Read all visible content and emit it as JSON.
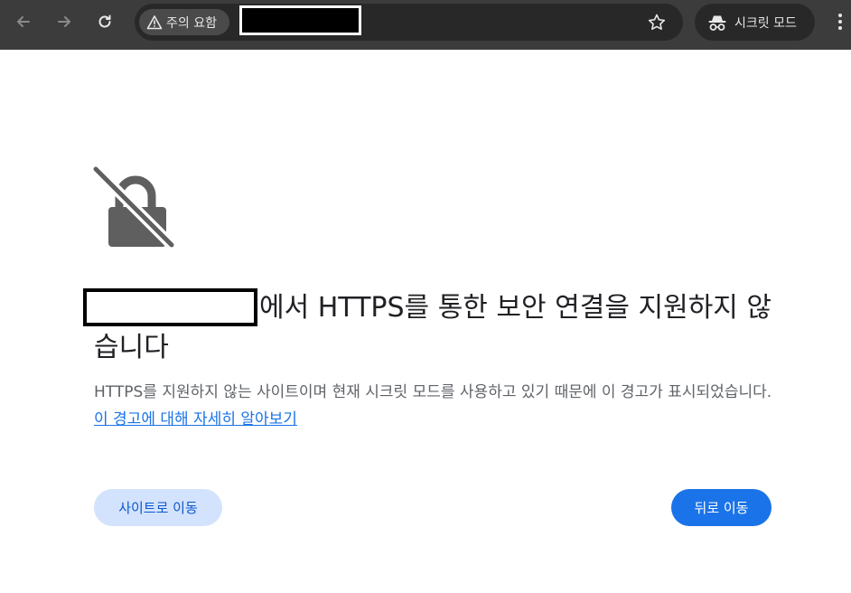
{
  "toolbar": {
    "back_icon": "arrow-left-icon",
    "forward_icon": "arrow-right-icon",
    "reload_icon": "reload-icon",
    "security_chip_label": "주의 요함",
    "security_chip_icon": "warning-triangle-icon",
    "bookmark_icon": "star-icon",
    "incognito_label": "시크릿 모드",
    "incognito_icon": "incognito-icon",
    "menu_icon": "more-vertical-icon",
    "colors": {
      "toolbar_bg": "#3c3c3c",
      "omnibox_bg": "#282828",
      "chip_bg": "#4a4a4a"
    }
  },
  "interstitial": {
    "icon": "lock-slash-icon",
    "headline": "에서 HTTPS를 통한 보안 연결을 지원하지 않습니다",
    "description": "HTTPS를 지원하지 않는 사이트이며 현재 시크릿 모드를 사용하고 있기 때문에 이 경고가 표시되었습니다.",
    "learn_more_link": "이 경고에 대해 자세히 알아보기",
    "proceed_button": "사이트로 이동",
    "back_button": "뒤로 이동",
    "colors": {
      "primary": "#1a73e8",
      "secondary_bg": "#d3e3fd",
      "secondary_text": "#0b57d0",
      "heading_text": "#202124",
      "body_text": "#5f6368"
    }
  }
}
